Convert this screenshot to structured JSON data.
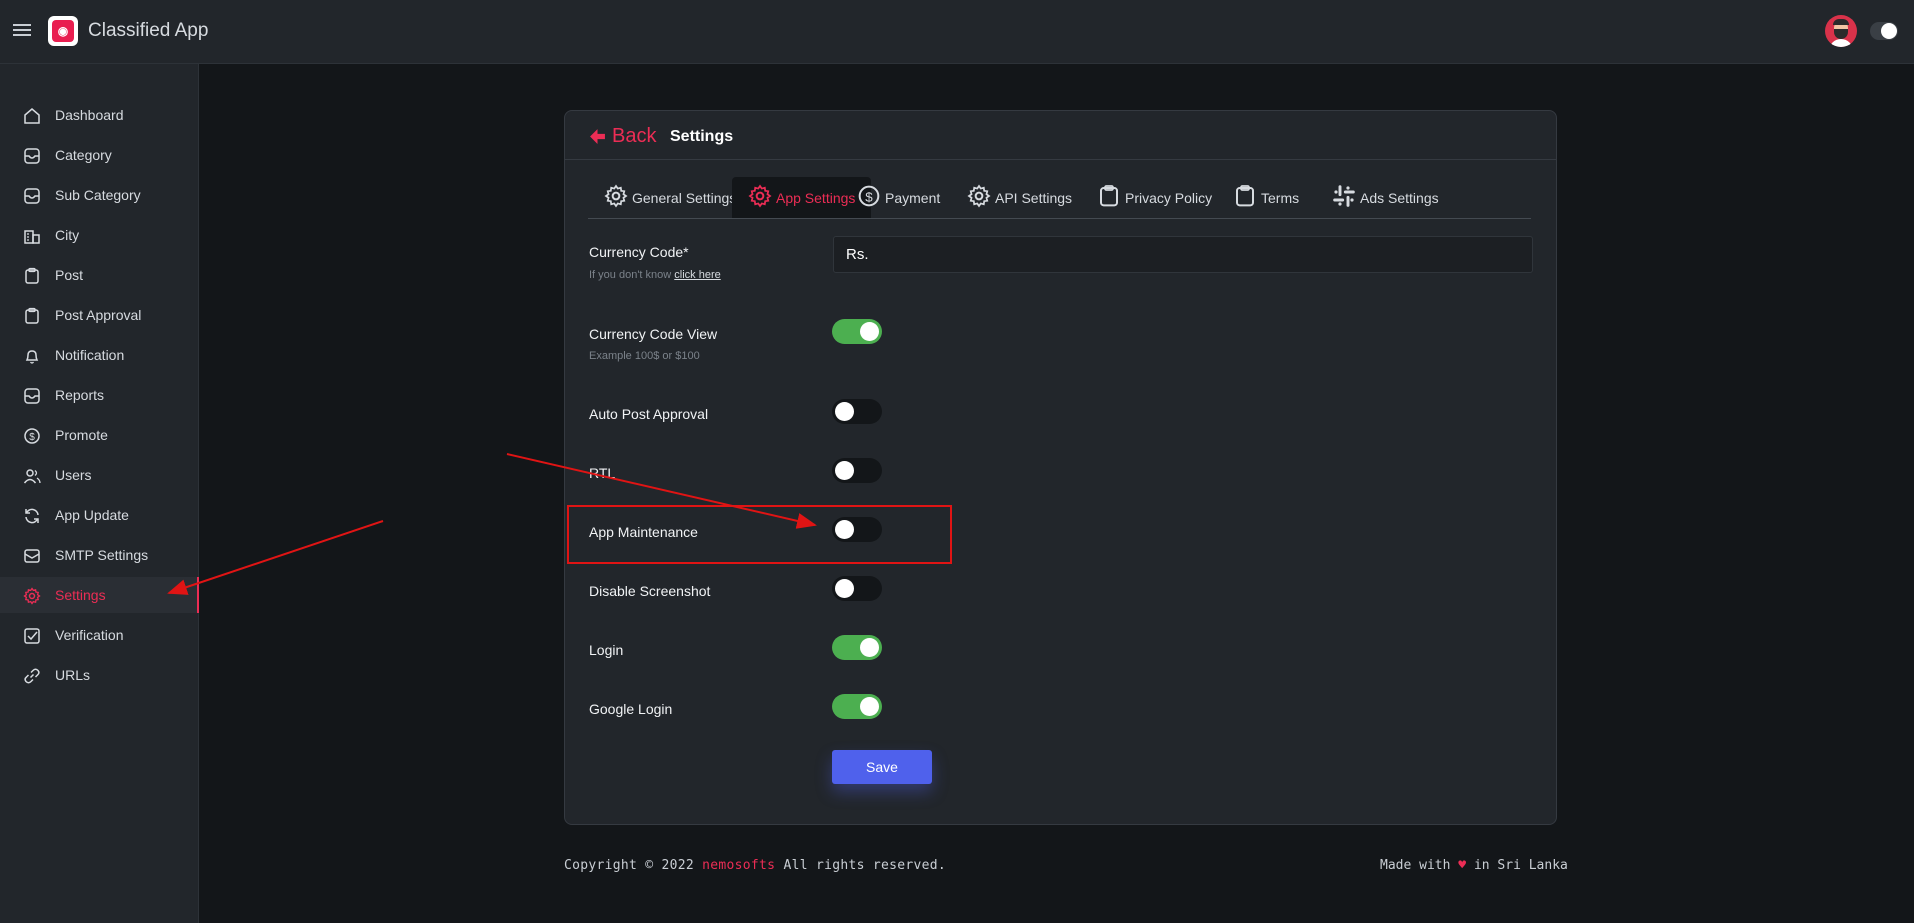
{
  "topbar": {
    "app_title": "Classified App",
    "logo_icon": "shopping-bag-icon",
    "menu_icon": "hamburger-icon"
  },
  "sidebar": {
    "items": [
      {
        "label": "Dashboard",
        "icon": "home-icon"
      },
      {
        "label": "Category",
        "icon": "inbox-icon"
      },
      {
        "label": "Sub Category",
        "icon": "inbox-icon"
      },
      {
        "label": "City",
        "icon": "building-icon"
      },
      {
        "label": "Post",
        "icon": "clipboard-icon"
      },
      {
        "label": "Post Approval",
        "icon": "clipboard-icon"
      },
      {
        "label": "Notification",
        "icon": "bell-icon"
      },
      {
        "label": "Reports",
        "icon": "inbox-icon"
      },
      {
        "label": "Promote",
        "icon": "dollar-icon"
      },
      {
        "label": "Users",
        "icon": "users-icon"
      },
      {
        "label": "App Update",
        "icon": "refresh-icon"
      },
      {
        "label": "SMTP Settings",
        "icon": "mail-icon"
      },
      {
        "label": "Settings",
        "icon": "gear-icon",
        "active": true
      },
      {
        "label": "Verification",
        "icon": "check-square-icon"
      },
      {
        "label": "URLs",
        "icon": "link-icon"
      }
    ]
  },
  "card": {
    "back_label": "Back",
    "title": "Settings",
    "tabs": [
      {
        "label": "General Settings",
        "icon": "gear-icon"
      },
      {
        "label": "App Settings",
        "icon": "gear-icon",
        "active": true
      },
      {
        "label": "Payment",
        "icon": "dollar-icon"
      },
      {
        "label": "API Settings",
        "icon": "gear-icon"
      },
      {
        "label": "Privacy Policy",
        "icon": "clipboard-icon"
      },
      {
        "label": "Terms",
        "icon": "clipboard-icon"
      },
      {
        "label": "Ads Settings",
        "icon": "slack-icon"
      }
    ],
    "currency_code": {
      "label": "Currency Code*",
      "hint_prefix": "If you don't know",
      "hint_link": "click here",
      "value": "Rs."
    },
    "toggles": [
      {
        "label": "Currency Code View",
        "hint": "Example 100$ or $100",
        "on": true
      },
      {
        "label": "Auto Post Approval",
        "on": false
      },
      {
        "label": "RTL",
        "on": false
      },
      {
        "label": "App Maintenance",
        "on": false
      },
      {
        "label": "Disable Screenshot",
        "on": false
      },
      {
        "label": "Login",
        "on": true
      },
      {
        "label": "Google Login",
        "on": true
      }
    ],
    "save_label": "Save"
  },
  "footer": {
    "copyright_prefix": "Copyright © 2022",
    "brand": "nemosofts",
    "copyright_suffix": "All rights reserved.",
    "made_prefix": "Made with",
    "made_suffix": "in Sri Lanka"
  },
  "colors": {
    "accent": "#ec2d55",
    "toggle_on": "#4caf50",
    "save_button": "#4f61ec",
    "annotation": "#e01414"
  }
}
